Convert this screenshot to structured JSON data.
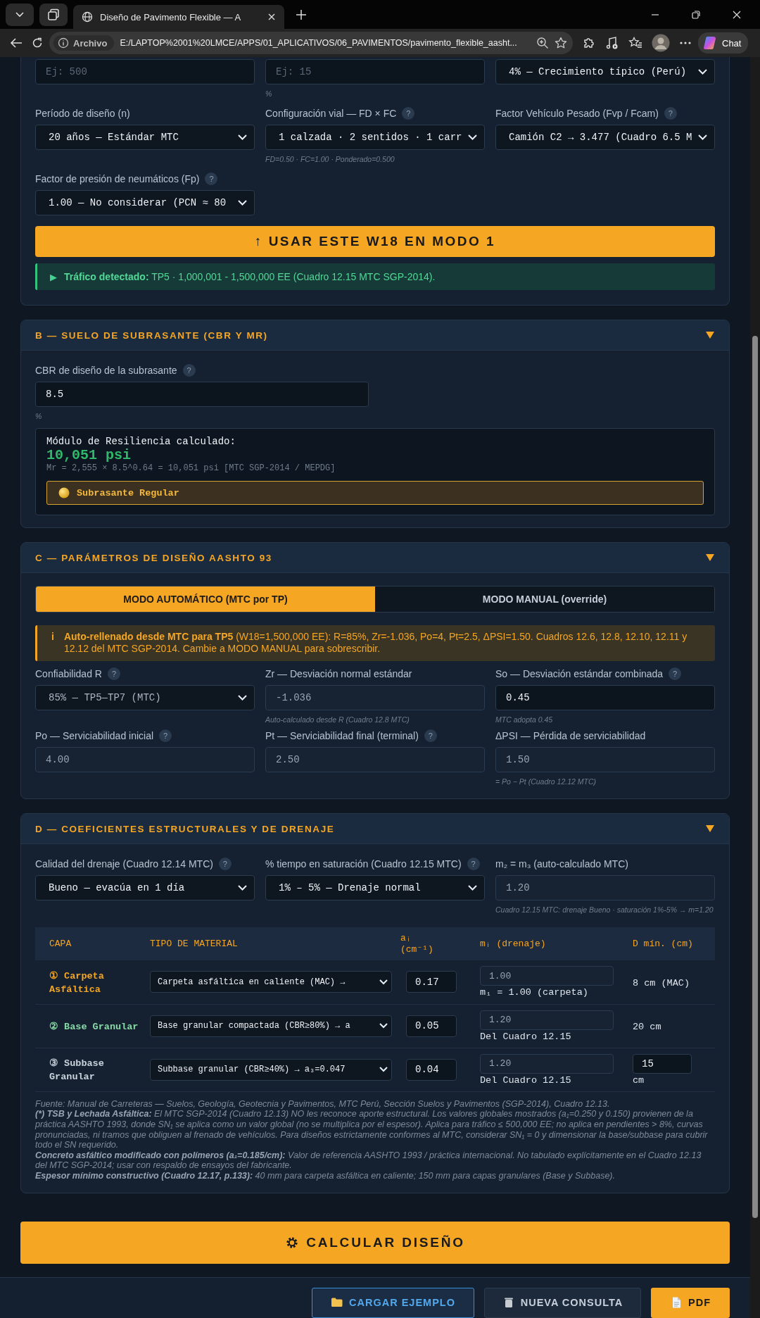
{
  "browser": {
    "tab_title": "Diseño de Pavimento Flexible — A",
    "site_label": "Archivo",
    "url": "E:/LAPTOP%2001%20LMCE/APPS/01_APLICATIVOS/06_PAVIMENTOS/pavimento_flexible_aasht...",
    "chat_label": "Chat"
  },
  "section_a": {
    "fields": [
      {
        "kind": "input",
        "placeholder": "Ej: 500"
      },
      {
        "kind": "input",
        "placeholder": "Ej: 15",
        "hint": "%"
      },
      {
        "kind": "select",
        "value": "4% — Crecimiento típico (Perú)",
        "disabled": false
      },
      {
        "label": "Período de diseño (n)",
        "kind": "select",
        "value": "20 años — Estándar MTC",
        "disabled": false
      },
      {
        "label": "Configuración vial — FD × FC",
        "help": "?",
        "kind": "select",
        "value": "1 calzada · 2 sentidos · 1 carr",
        "disabled": false,
        "hint": "FD=0.50 · FC=1.00 · Ponderado=0.500"
      },
      {
        "label": "Factor Vehículo Pesado (Fvp / Fcam)",
        "help": "?",
        "kind": "select",
        "value": "Camión C2 → 3.477 (Cuadro 6.5 M",
        "disabled": false
      },
      {
        "label": "Factor de presión de neumáticos (Fp)",
        "help": "?",
        "kind": "select",
        "value": "1.00 — No considerar (PCN ≈ 80",
        "disabled": false
      }
    ],
    "action": "↑ USAR ESTE W18 EN MODO 1",
    "alert": {
      "icon": "▶",
      "text": "**Tráfico detectado:** TP5 · 1,000,001 - 1,500,000 EE (Cuadro 12.15 MTC SGP-2014)."
    }
  },
  "section_b": {
    "title": "B — SUELO DE SUBRASANTE (CBR Y MR)",
    "expanded": true,
    "fields": [
      {
        "label": "CBR de diseño de la subrasante",
        "help": "?",
        "kind": "input",
        "value": "8.5",
        "disabled": false,
        "hint": "%"
      }
    ],
    "result": {
      "heading": "Módulo de Resiliencia calculado:",
      "value": "10,051 psi",
      "formula": "Mr = 2,555 × 8.5^0.64 = 10,051 psi [MTC SGP-2014 / MEPDG]",
      "badge": "Subrasante Regular"
    }
  },
  "section_c": {
    "title": "C — PARÁMETROS DE DISEÑO AASHTO 93",
    "expanded": true,
    "modes": [
      {
        "label": "MODO AUTOMÁTICO (MTC por TP)",
        "selected": true
      },
      {
        "label": "MODO MANUAL (override)",
        "selected": false
      }
    ],
    "notice": {
      "icon": "i",
      "text": "**Auto-rellenado desde MTC para TP5** (W18=1,500,000 EE): R=85%, Zr=-1.036, Po=4, Pt=2.5, ΔPSI=1.50. Cuadros 12.6, 12.8, 12.10, 12.11 y 12.12 del MTC SGP-2014. Cambie a MODO MANUAL para sobrescribir."
    },
    "fields": [
      {
        "label": "Confiabilidad R",
        "help": "?",
        "kind": "select",
        "value": "85% — TP5—TP7 (MTC)",
        "disabled": true
      },
      {
        "label": "Zr — Desviación normal estándar",
        "kind": "input",
        "value": "-1.036",
        "disabled": true,
        "hint": "Auto-calculado desde R (Cuadro 12.8 MTC)"
      },
      {
        "label": "So — Desviación estándar combinada",
        "help": "?",
        "kind": "input",
        "value": "0.45",
        "disabled": false,
        "hint": "MTC adopta 0.45"
      },
      {
        "label": "Po — Serviciabilidad inicial",
        "help": "?",
        "kind": "input",
        "value": "4.00",
        "disabled": true
      },
      {
        "label": "Pt — Serviciabilidad final (terminal)",
        "help": "?",
        "kind": "input",
        "value": "2.50",
        "disabled": true
      },
      {
        "label": "ΔPSI — Pérdida de serviciabilidad",
        "kind": "input",
        "value": "1.50",
        "disabled": true,
        "hint": "= Po − Pt (Cuadro 12.12 MTC)"
      }
    ]
  },
  "section_d": {
    "title": "D — COEFICIENTES ESTRUCTURALES Y DE DRENAJE",
    "expanded": true,
    "fields": [
      {
        "label": "Calidad del drenaje (Cuadro 12.14 MTC)",
        "help": "?",
        "kind": "select",
        "value": "Bueno — evacúa en 1 día",
        "disabled": false
      },
      {
        "label": "% tiempo en saturación (Cuadro 12.15 MTC)",
        "help": "?",
        "kind": "select",
        "value": "1% – 5% — Drenaje normal",
        "disabled": false
      },
      {
        "label": "m₂ = m₃ (auto-calculado MTC)",
        "kind": "input",
        "value": "1.20",
        "disabled": true,
        "hint": "Cuadro 12.15 MTC: drenaje Bueno · saturación 1%-5% → m=1.20"
      }
    ],
    "table": {
      "columns": [
        "CAPA",
        "TIPO DE MATERIAL",
        "aᵢ (cm⁻¹)",
        "mᵢ (drenaje)",
        "D mín. (cm)"
      ],
      "rows": [
        {
          "layer": "① Carpeta Asfáltica",
          "color": "#f5a623",
          "material": "Carpeta asfáltica en caliente (MAC) →",
          "a": "0.17",
          "m": "1.00",
          "m_note": "m₁ = 1.00 (carpeta)",
          "kind": "text",
          "d": "8 cm (MAC)"
        },
        {
          "layer": "② Base Granular",
          "color": "#86d9a4",
          "material": "Base granular compactada (CBR≥80%) → a",
          "a": "0.05",
          "m": "1.20",
          "m_note": "Del Cuadro 12.15",
          "kind": "text",
          "d": "20 cm"
        },
        {
          "layer": "③ Subbase Granular",
          "color": "#c9d1da",
          "material": "Subbase granular (CBR≥40%) → a₃=0.047",
          "a": "0.04",
          "m": "1.20",
          "m_note": "Del Cuadro 12.15",
          "kind": "input",
          "d": "15",
          "d_unit": "cm"
        }
      ]
    },
    "notes": [
      "Fuente: Manual de Carreteras — Suelos, Geología, Geotecnia y Pavimentos, MTC Perú, Sección Suelos y Pavimentos (SGP-2014), Cuadro 12.13.",
      "**(*) TSB y Lechada Asfáltica:** El MTC SGP-2014 (Cuadro 12.13) NO les reconoce aporte estructural. Los valores globales mostrados (a₁=0.250 y 0.150) provienen de la práctica AASHTO 1993, donde SN₁ se aplica como un valor global (no se multiplica por el espesor). Aplica para tráfico ≤ 500,000 EE; no aplica en pendientes > 8%, curvas pronunciadas, ni tramos que obliguen al frenado de vehículos. Para diseños estrictamente conformes al MTC, considerar SN₁ = 0 y dimensionar la base/subbase para cubrir todo el SN requerido.",
      "**Concreto asfáltico modificado con polímeros (a₁=0.185/cm):** Valor de referencia AASHTO 1993 / práctica internacional. No tabulado explícitamente en el Cuadro 12.13 del MTC SGP-2014; usar con respaldo de ensayos del fabricante.",
      "**Espesor mínimo constructivo (Cuadro 12.17, p.133):** 40 mm para carpeta asfáltica en caliente; 150 mm para capas granulares (Base y Subbase)."
    ]
  },
  "calculate": "CALCULAR DISEÑO",
  "footer_buttons": [
    {
      "kind": "load",
      "label": "CARGAR EJEMPLO"
    },
    {
      "kind": "reset",
      "label": "NUEVA CONSULTA"
    },
    {
      "kind": "pdf",
      "label": "PDF"
    }
  ]
}
